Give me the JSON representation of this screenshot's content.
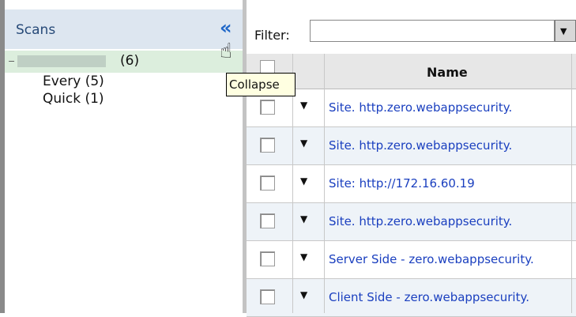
{
  "sidebar": {
    "title": "Scans",
    "tree": {
      "root_count": "(6)",
      "children": [
        "Every (5)",
        "Quick (1)"
      ]
    }
  },
  "tooltip": "Collapse",
  "filter": {
    "label": "Filter:",
    "value": ""
  },
  "grid": {
    "headers": {
      "name": "Name"
    },
    "rows": [
      "Site. http.zero.webappsecurity.",
      "Site. http.zero.webappsecurity.",
      "Site: http://172.16.60.19",
      "Site. http.zero.webappsecurity.",
      "Server Side - zero.webappsecurity.",
      "Client Side - zero.webappsecurity."
    ]
  }
}
